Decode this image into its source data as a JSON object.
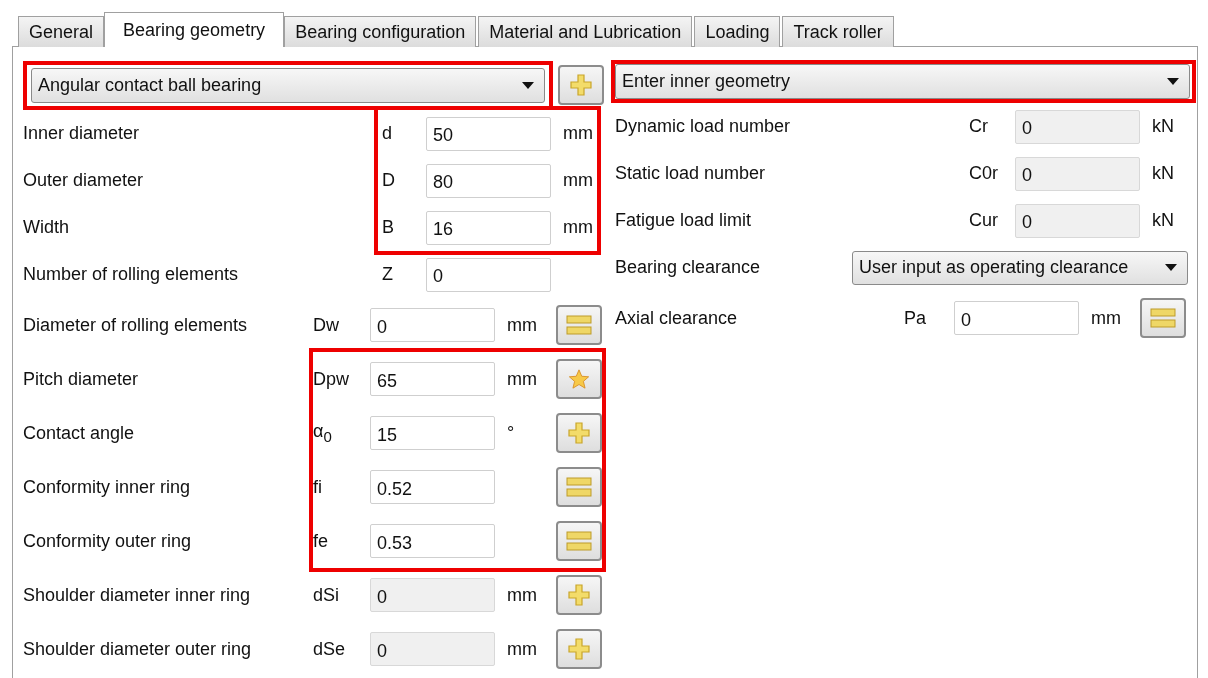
{
  "tabs": [
    {
      "label": "General",
      "selected": false
    },
    {
      "label": "Bearing geometry",
      "selected": true
    },
    {
      "label": "Bearing configuration",
      "selected": false
    },
    {
      "label": "Material and Lubrication",
      "selected": false
    },
    {
      "label": "Loading",
      "selected": false
    },
    {
      "label": "Track roller",
      "selected": false
    }
  ],
  "left": {
    "type_select": {
      "value": "Angular contact ball bearing",
      "highlighted": true
    },
    "type_button": {
      "kind": "plus"
    },
    "groups": [
      {
        "highlighted": true,
        "kind": "right",
        "rows": [
          {
            "label": "Inner diameter",
            "symbol": "d",
            "value": "50",
            "unit": "mm",
            "disabled": false
          },
          {
            "label": "Outer diameter",
            "symbol": "D",
            "value": "80",
            "unit": "mm",
            "disabled": false
          },
          {
            "label": "Width",
            "symbol": "B",
            "value": "16",
            "unit": "mm",
            "disabled": false
          }
        ]
      },
      {
        "highlighted": false,
        "kind": "right",
        "rows": [
          {
            "label": "Number of rolling elements",
            "symbol": "Z",
            "value": "0",
            "disabled": false
          }
        ]
      },
      {
        "highlighted": false,
        "kind": "left",
        "rows": [
          {
            "label": "Diameter of rolling elements",
            "symbol": "Dw",
            "value": "0",
            "unit": "mm",
            "button": {
              "kind": "equals"
            },
            "disabled": false
          }
        ]
      },
      {
        "highlighted": true,
        "kind": "left",
        "rows": [
          {
            "label": "Pitch diameter",
            "symbol": "Dpw",
            "value": "65",
            "unit": "mm",
            "button": {
              "kind": "star"
            },
            "disabled": false
          },
          {
            "label": "Contact angle",
            "symbol": "α$_{0}$",
            "value": "15",
            "unit": "°",
            "button": {
              "kind": "plus"
            },
            "disabled": false
          },
          {
            "label": "Conformity inner ring",
            "symbol": "fi",
            "value": "0.52",
            "button": {
              "kind": "equals"
            },
            "disabled": false
          },
          {
            "label": "Conformity outer ring",
            "symbol": "fe",
            "value": "0.53",
            "button": {
              "kind": "equals"
            },
            "disabled": false
          }
        ]
      },
      {
        "highlighted": false,
        "kind": "left",
        "rows": [
          {
            "label": "Shoulder diameter inner ring",
            "symbol": "dSi",
            "value": "0",
            "unit": "mm",
            "button": {
              "kind": "plus"
            },
            "disabled": true
          },
          {
            "label": "Shoulder diameter outer ring",
            "symbol": "dSe",
            "value": "0",
            "unit": "mm",
            "button": {
              "kind": "plus"
            },
            "disabled": true
          }
        ]
      }
    ]
  },
  "right": {
    "mode_select": {
      "value": "Enter inner geometry",
      "highlighted": true
    },
    "rows": [
      {
        "label": "Dynamic load number",
        "symbol": "Cr",
        "value": "0",
        "unit": "kN",
        "disabled": true
      },
      {
        "label": "Static load number",
        "symbol": "C0r",
        "value": "0",
        "unit": "kN",
        "disabled": true
      },
      {
        "label": "Fatigue load limit",
        "symbol": "Cur",
        "value": "0",
        "unit": "kN",
        "disabled": true
      }
    ],
    "clearance": {
      "label": "Bearing clearance",
      "value": "User input as operating clearance"
    },
    "axial": {
      "label": "Axial clearance",
      "symbol": "Pa",
      "value": "0",
      "unit": "mm",
      "button": {
        "kind": "equals"
      },
      "disabled": false
    }
  }
}
